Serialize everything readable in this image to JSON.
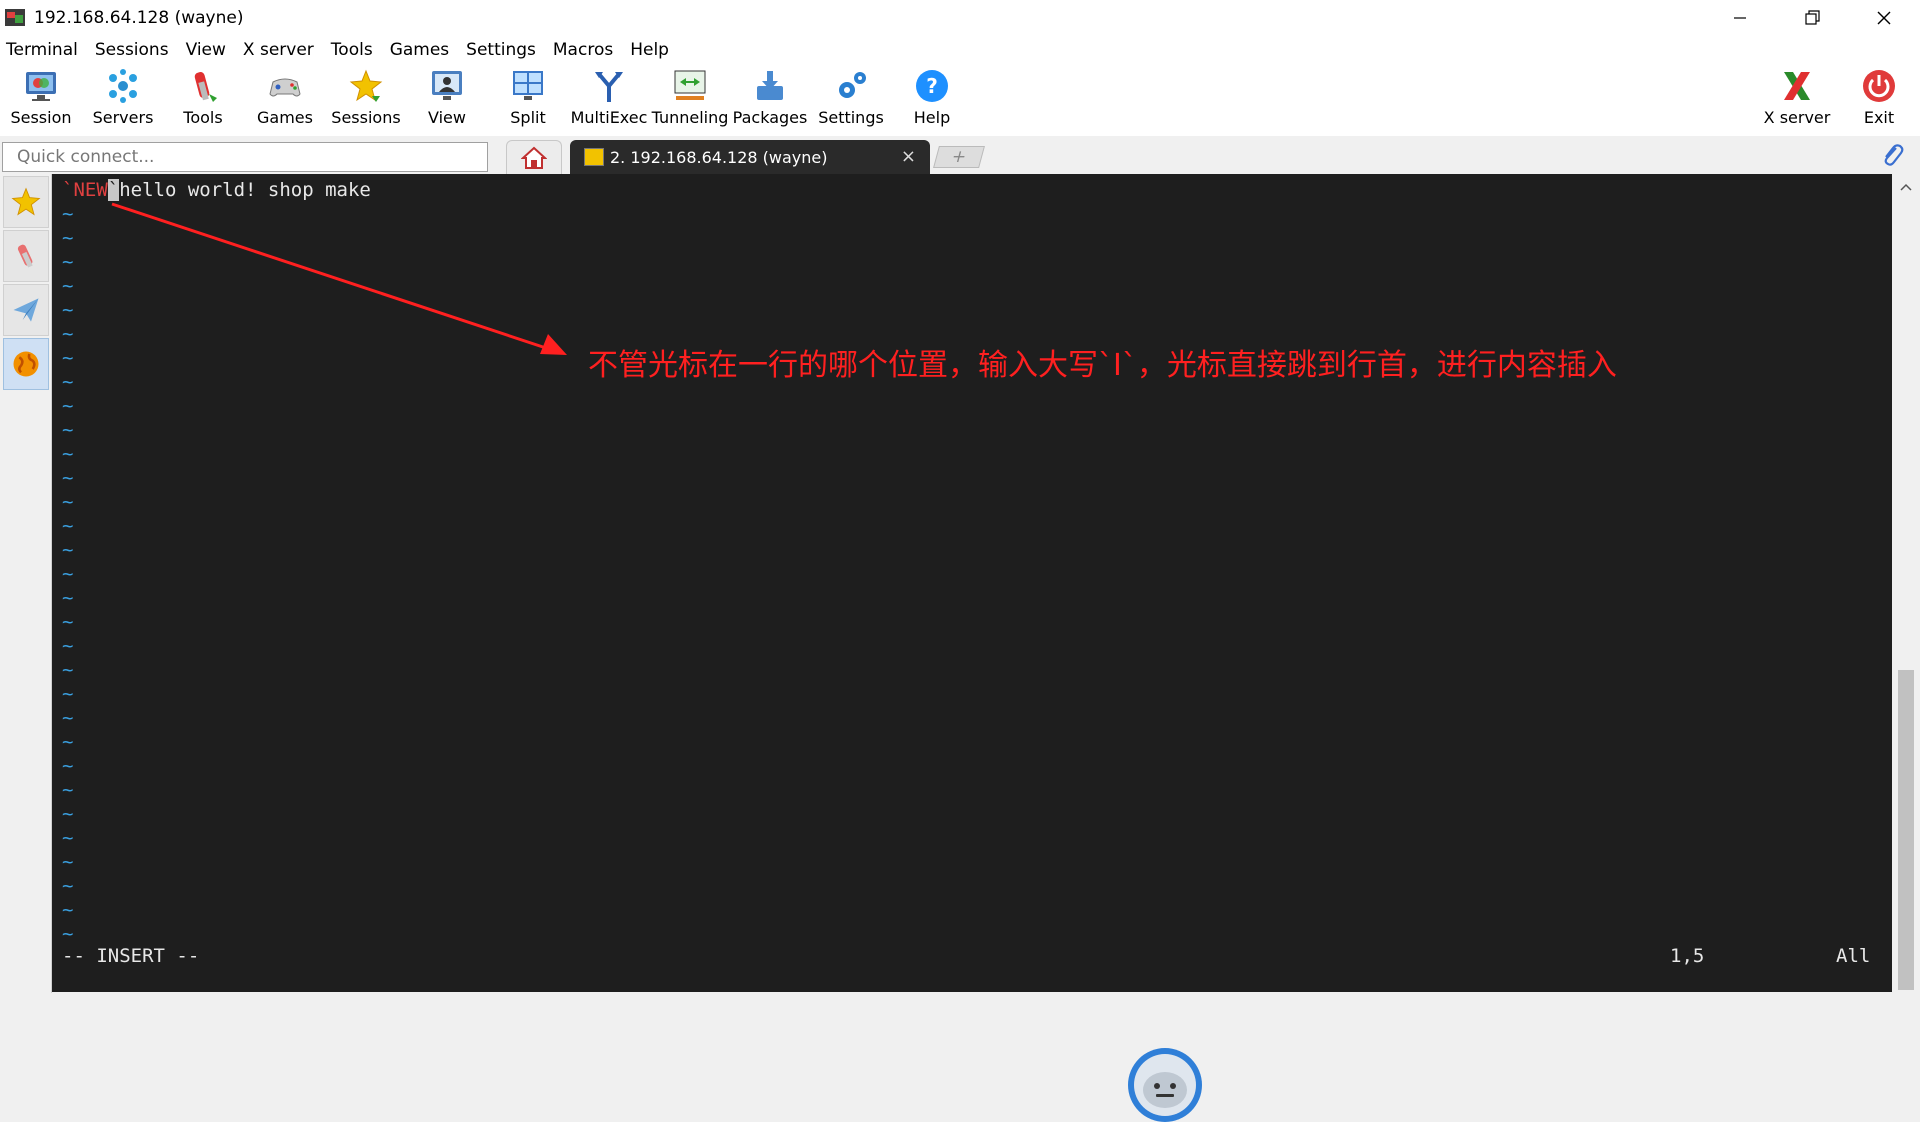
{
  "window": {
    "title": "192.168.64.128 (wayne)"
  },
  "menu": [
    "Terminal",
    "Sessions",
    "View",
    "X server",
    "Tools",
    "Games",
    "Settings",
    "Macros",
    "Help"
  ],
  "toolbar": {
    "left": [
      {
        "label": "Session",
        "icon": "session-icon"
      },
      {
        "label": "Servers",
        "icon": "servers-icon"
      },
      {
        "label": "Tools",
        "icon": "tools-icon"
      },
      {
        "label": "Games",
        "icon": "games-icon"
      },
      {
        "label": "Sessions",
        "icon": "sessions-star-icon"
      },
      {
        "label": "View",
        "icon": "view-icon"
      },
      {
        "label": "Split",
        "icon": "split-icon"
      },
      {
        "label": "MultiExec",
        "icon": "multiexec-icon"
      },
      {
        "label": "Tunneling",
        "icon": "tunneling-icon"
      },
      {
        "label": "Packages",
        "icon": "packages-icon"
      },
      {
        "label": "Settings",
        "icon": "settings-icon"
      },
      {
        "label": "Help",
        "icon": "help-icon"
      }
    ],
    "right": [
      {
        "label": "X server",
        "icon": "xserver-icon"
      },
      {
        "label": "Exit",
        "icon": "exit-icon"
      }
    ]
  },
  "quick_connect": {
    "placeholder": "Quick connect..."
  },
  "tabs": {
    "active_label": "2. 192.168.64.128 (wayne)",
    "close": "×",
    "new": "+"
  },
  "terminal": {
    "line1_prefix": "`NEW",
    "line1_cursor": "`",
    "line1_text": "hello world! shop make",
    "tilde": "~",
    "mode": "-- INSERT --",
    "position": "1,5",
    "scroll": "All"
  },
  "annotation": "不管光标在一行的哪个位置，输入大写`I`，光标直接跳到行首，进行内容插入",
  "colors": {
    "terminal_bg": "#1e1e1e",
    "tilde": "#3aa0e0",
    "annotation": "#ff2020"
  }
}
